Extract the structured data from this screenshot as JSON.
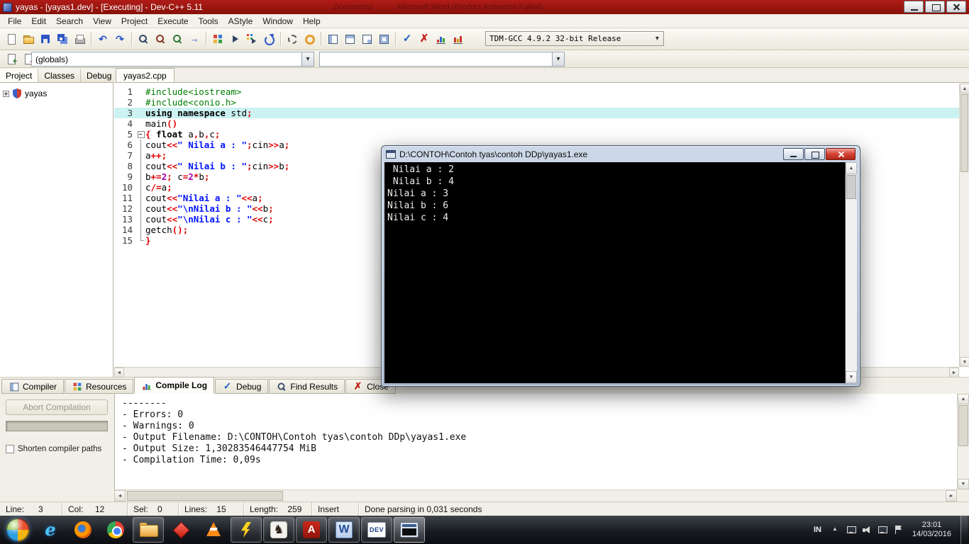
{
  "colors": {
    "titlebar": "#9b1512",
    "ui_beige": "#f1efe7",
    "highlight_line": "#ccf2f2",
    "console_bg": "#000000",
    "syntax": {
      "preprocessor": "#007d00",
      "keyword": "#000000",
      "string": "#0014ff",
      "symbol": "#e00000",
      "number": "#aa00aa"
    }
  },
  "window": {
    "title": "yayas - [yayas1.dev] - [Executing] - Dev-C++ 5.11",
    "background_hint1": "Documents",
    "background_hint2": "Microsoft Word (Product Activation Failed)"
  },
  "menu": {
    "items": [
      "File",
      "Edit",
      "Search",
      "View",
      "Project",
      "Execute",
      "Tools",
      "AStyle",
      "Window",
      "Help"
    ]
  },
  "toolbar": {
    "compiler_selected": "TDM-GCC 4.9.2 32-bit Release",
    "buttons": [
      {
        "name": "new-file-button",
        "icon": "page",
        "icon_name": "new-file-icon",
        "inter": "true"
      },
      {
        "name": "open-file-button",
        "icon": "folder",
        "icon_name": "open-folder-icon",
        "inter": "true"
      },
      {
        "name": "save-button",
        "icon": "floppy",
        "icon_name": "save-icon",
        "inter": "true"
      },
      {
        "name": "save-all-button",
        "icon": "floppy2",
        "icon_name": "save-all-icon",
        "inter": "true"
      },
      {
        "name": "print-button",
        "icon": "printer",
        "icon_name": "print-icon",
        "inter": "true"
      },
      {
        "name": "toolbar-separator",
        "icon": "sep",
        "kind": "sep",
        "icon_name": "separator",
        "inter": "false"
      },
      {
        "name": "undo-button",
        "icon": "undo",
        "icon_name": "undo-icon",
        "inter": "true"
      },
      {
        "name": "redo-button",
        "icon": "redo",
        "icon_name": "redo-icon",
        "inter": "true"
      },
      {
        "name": "toolbar-separator",
        "icon": "sep",
        "kind": "sep",
        "icon_name": "separator",
        "inter": "false"
      },
      {
        "name": "find-button",
        "icon": "find",
        "icon_name": "find-icon",
        "inter": "true"
      },
      {
        "name": "replace-button",
        "icon": "replace",
        "icon_name": "replace-icon",
        "inter": "true"
      },
      {
        "name": "find-next-button",
        "icon": "findnav",
        "icon_name": "find-next-icon",
        "inter": "true"
      },
      {
        "name": "goto-line-button",
        "icon": "goto",
        "icon_name": "goto-line-icon",
        "inter": "true"
      },
      {
        "name": "toolbar-separator",
        "icon": "sep",
        "kind": "sep",
        "icon_name": "separator",
        "inter": "false"
      },
      {
        "name": "compile-button",
        "icon": "compile",
        "icon_name": "compile-icon",
        "inter": "true"
      },
      {
        "name": "run-button",
        "icon": "run",
        "icon_name": "run-icon",
        "inter": "true"
      },
      {
        "name": "compile-run-button",
        "icon": "comprun",
        "icon_name": "compile-run-icon",
        "inter": "true"
      },
      {
        "name": "rebuild-button",
        "icon": "rebuild",
        "icon_name": "rebuild-icon",
        "inter": "true"
      },
      {
        "name": "toolbar-separator",
        "icon": "sep",
        "kind": "sep",
        "icon_name": "separator",
        "inter": "false"
      },
      {
        "name": "debug-button",
        "icon": "gear",
        "icon_name": "debug-icon",
        "inter": "true"
      },
      {
        "name": "profile-button",
        "icon": "donut",
        "icon_name": "profile-icon",
        "inter": "true"
      },
      {
        "name": "toolbar-separator",
        "icon": "sep",
        "kind": "sep",
        "icon_name": "separator",
        "inter": "false"
      },
      {
        "name": "toggle-project-panel-button",
        "icon": "grid-a",
        "icon_name": "panel-layout-left-icon",
        "inter": "true"
      },
      {
        "name": "toggle-report-panel-button",
        "icon": "grid-b",
        "icon_name": "panel-layout-top-icon",
        "inter": "true"
      },
      {
        "name": "toggle-output-panel-button",
        "icon": "grid-c",
        "icon_name": "panel-layout-corner-icon",
        "inter": "true"
      },
      {
        "name": "toggle-fullscreen-button",
        "icon": "grid-d",
        "icon_name": "panel-layout-full-icon",
        "inter": "true"
      },
      {
        "name": "toolbar-separator",
        "icon": "sep",
        "kind": "sep",
        "icon_name": "separator",
        "inter": "false"
      },
      {
        "name": "syntax-check-button",
        "icon": "check",
        "icon_name": "syntax-check-icon",
        "inter": "true"
      },
      {
        "name": "abort-compilation-toolbar-button",
        "icon": "abortx",
        "icon_name": "abort-icon",
        "inter": "true"
      },
      {
        "name": "profile-analysis-button",
        "icon": "chart",
        "icon_name": "profile-chart-icon",
        "inter": "true"
      },
      {
        "name": "delete-profiling-button",
        "icon": "chart2",
        "icon_name": "delete-profiling-icon",
        "inter": "true"
      }
    ]
  },
  "toolbar2": {
    "globals_selected": "(globals)",
    "members_selected": "",
    "buttons": [
      {
        "name": "add-to-project-button",
        "icon": "pageplus",
        "icon_name": "add-file-icon",
        "inter": "true"
      },
      {
        "name": "remove-from-project-button",
        "icon": "pageminus",
        "icon_name": "remove-file-icon",
        "inter": "true"
      },
      {
        "name": "project-options-button",
        "icon": "pagegear",
        "icon_name": "project-options-icon",
        "inter": "true"
      }
    ]
  },
  "left_panel": {
    "tabs": [
      {
        "label": "Project",
        "name": "tab-project",
        "state": "active"
      },
      {
        "label": "Classes",
        "name": "tab-classes"
      },
      {
        "label": "Debug",
        "name": "tab-debug"
      }
    ],
    "tree_item": "yayas"
  },
  "editor": {
    "tab": "yayas2.cpp",
    "lines": [
      {
        "n": "1",
        "tokens": [
          {
            "t": "#include<iostream>",
            "c": "pp"
          }
        ]
      },
      {
        "n": "2",
        "tokens": [
          {
            "t": "#include<conio.h>",
            "c": "pp"
          }
        ]
      },
      {
        "n": "3",
        "hl": true,
        "tokens": [
          {
            "t": "using namespace",
            "c": "kw"
          },
          {
            "t": " std",
            "c": "id"
          },
          {
            "t": ";",
            "c": "sym"
          }
        ]
      },
      {
        "n": "4",
        "tokens": [
          {
            "t": "main",
            "c": "id"
          },
          {
            "t": "()",
            "c": "sym"
          }
        ]
      },
      {
        "n": "5",
        "fold": "start",
        "tokens": [
          {
            "t": "{ ",
            "c": "sym"
          },
          {
            "t": "float",
            "c": "kw"
          },
          {
            "t": " a",
            "c": "id"
          },
          {
            "t": ",",
            "c": "sym"
          },
          {
            "t": "b",
            "c": "id"
          },
          {
            "t": ",",
            "c": "sym"
          },
          {
            "t": "c",
            "c": "id"
          },
          {
            "t": ";",
            "c": "sym"
          }
        ]
      },
      {
        "n": "6",
        "fold": "mid",
        "tokens": [
          {
            "t": "cout",
            "c": "id"
          },
          {
            "t": "<<",
            "c": "sym"
          },
          {
            "t": "\" Nilai a : \"",
            "c": "str"
          },
          {
            "t": ";",
            "c": "sym"
          },
          {
            "t": "cin",
            "c": "id"
          },
          {
            "t": ">>",
            "c": "sym"
          },
          {
            "t": "a",
            "c": "id"
          },
          {
            "t": ";",
            "c": "sym"
          }
        ]
      },
      {
        "n": "7",
        "fold": "mid",
        "tokens": [
          {
            "t": "a",
            "c": "id"
          },
          {
            "t": "++;",
            "c": "sym"
          }
        ]
      },
      {
        "n": "8",
        "fold": "mid",
        "tokens": [
          {
            "t": "cout",
            "c": "id"
          },
          {
            "t": "<<",
            "c": "sym"
          },
          {
            "t": "\" Nilai b : \"",
            "c": "str"
          },
          {
            "t": ";",
            "c": "sym"
          },
          {
            "t": "cin",
            "c": "id"
          },
          {
            "t": ">>",
            "c": "sym"
          },
          {
            "t": "b",
            "c": "id"
          },
          {
            "t": ";",
            "c": "sym"
          }
        ]
      },
      {
        "n": "9",
        "fold": "mid",
        "tokens": [
          {
            "t": "b",
            "c": "id"
          },
          {
            "t": "+=",
            "c": "sym"
          },
          {
            "t": "2",
            "c": "num"
          },
          {
            "t": "; ",
            "c": "sym"
          },
          {
            "t": "c",
            "c": "id"
          },
          {
            "t": "=",
            "c": "sym"
          },
          {
            "t": "2",
            "c": "num"
          },
          {
            "t": "*",
            "c": "sym"
          },
          {
            "t": "b",
            "c": "id"
          },
          {
            "t": ";",
            "c": "sym"
          }
        ]
      },
      {
        "n": "10",
        "fold": "mid",
        "tokens": [
          {
            "t": "c",
            "c": "id"
          },
          {
            "t": "/=",
            "c": "sym"
          },
          {
            "t": "a",
            "c": "id"
          },
          {
            "t": ";",
            "c": "sym"
          }
        ]
      },
      {
        "n": "11",
        "fold": "mid",
        "tokens": [
          {
            "t": "cout",
            "c": "id"
          },
          {
            "t": "<<",
            "c": "sym"
          },
          {
            "t": "\"Nilai a : \"",
            "c": "str"
          },
          {
            "t": "<<",
            "c": "sym"
          },
          {
            "t": "a",
            "c": "id"
          },
          {
            "t": ";",
            "c": "sym"
          }
        ]
      },
      {
        "n": "12",
        "fold": "mid",
        "tokens": [
          {
            "t": "cout",
            "c": "id"
          },
          {
            "t": "<<",
            "c": "sym"
          },
          {
            "t": "\"\\nNilai b : \"",
            "c": "str"
          },
          {
            "t": "<<",
            "c": "sym"
          },
          {
            "t": "b",
            "c": "id"
          },
          {
            "t": ";",
            "c": "sym"
          }
        ]
      },
      {
        "n": "13",
        "fold": "mid",
        "tokens": [
          {
            "t": "cout",
            "c": "id"
          },
          {
            "t": "<<",
            "c": "sym"
          },
          {
            "t": "\"\\nNilai c : \"",
            "c": "str"
          },
          {
            "t": "<<",
            "c": "sym"
          },
          {
            "t": "c",
            "c": "id"
          },
          {
            "t": ";",
            "c": "sym"
          }
        ]
      },
      {
        "n": "14",
        "fold": "mid",
        "tokens": [
          {
            "t": "getch",
            "c": "id"
          },
          {
            "t": "();",
            "c": "sym"
          }
        ]
      },
      {
        "n": "15",
        "fold": "end",
        "tokens": [
          {
            "t": "}",
            "c": "sym"
          }
        ]
      }
    ]
  },
  "console": {
    "title": "D:\\CONTOH\\Contoh tyas\\contoh DDp\\yayas1.exe",
    "lines": [
      " Nilai a : 2",
      " Nilai b : 4",
      "Nilai a : 3",
      "Nilai b : 6",
      "Nilai c : 4"
    ]
  },
  "bottom_tabs": [
    {
      "label": "Compiler",
      "name": "tab-compiler",
      "icon": "grid-a",
      "icon_name": "compiler-tab-icon"
    },
    {
      "label": "Resources",
      "name": "tab-resources",
      "icon": "compile",
      "icon_name": "resources-tab-icon"
    },
    {
      "label": "Compile Log",
      "name": "tab-compile-log",
      "icon": "chart",
      "icon_name": "compile-log-tab-icon",
      "state": "active"
    },
    {
      "label": "Debug",
      "name": "tab-debug-bottom",
      "icon": "check",
      "icon_name": "debug-tab-icon"
    },
    {
      "label": "Find Results",
      "name": "tab-find-results",
      "icon": "find",
      "icon_name": "find-results-tab-icon"
    },
    {
      "label": "Close",
      "name": "tab-close",
      "icon": "abortx",
      "icon_name": "close-tab-icon"
    }
  ],
  "compile_panel": {
    "abort_button": "Abort Compilation",
    "shorten_label": "Shorten compiler paths",
    "log": [
      "--------",
      "- Errors: 0",
      "- Warnings: 0",
      "- Output Filename: D:\\CONTOH\\Contoh tyas\\contoh DDp\\yayas1.exe",
      "- Output Size: 1,30283546447754 MiB",
      "- Compilation Time: 0,09s"
    ]
  },
  "status_bar": {
    "segments": [
      "Line:      3",
      "Col:     12",
      "Sel:    0",
      "Lines:    15",
      "Length:    259",
      "Insert",
      "Done parsing in 0,031 seconds"
    ]
  },
  "taskbar": {
    "items": [
      {
        "name": "taskbar-internet-explorer",
        "icon": "ic-ie",
        "icon_name": "internet-explorer-icon"
      },
      {
        "name": "taskbar-firefox",
        "icon": "ic-firefox",
        "icon_name": "firefox-icon"
      },
      {
        "name": "taskbar-chrome",
        "icon": "ic-chrome",
        "icon_name": "chrome-icon"
      },
      {
        "name": "taskbar-explorer",
        "icon": "ic-folder",
        "icon_name": "explorer-folder-icon",
        "state": "open"
      },
      {
        "name": "taskbar-red-diamond-app",
        "icon": "ic-diamond",
        "icon_name": "red-diamond-icon"
      },
      {
        "name": "taskbar-media-app",
        "icon": "ic-cone",
        "icon_name": "orange-cone-icon"
      },
      {
        "name": "taskbar-winamp",
        "icon": "ic-lightning",
        "icon_name": "lightning-icon",
        "state": "open"
      },
      {
        "name": "taskbar-kangaroo-app",
        "icon": "ic-kangaroo",
        "icon_name": "kangaroo-icon",
        "state": "open"
      },
      {
        "name": "taskbar-adobe-reader",
        "icon": "ic-adobe",
        "icon_name": "adobe-reader-icon",
        "state": "open"
      },
      {
        "name": "taskbar-word",
        "icon": "ic-word",
        "icon_name": "word-icon",
        "state": "open"
      },
      {
        "name": "taskbar-dev-cpp",
        "icon": "ic-dev",
        "icon_name": "dev-cpp-icon",
        "state": "open"
      },
      {
        "name": "taskbar-console-window",
        "icon": "ic-console",
        "icon_name": "console-window-icon",
        "state": "active"
      }
    ],
    "tray": {
      "language": "IN",
      "icons": [
        {
          "name": "hidden-icons-button",
          "kind": "arrowup"
        },
        {
          "name": "display-icon",
          "kind": "monitor"
        },
        {
          "name": "volume-icon",
          "kind": "volume"
        },
        {
          "name": "network-icon",
          "kind": "monitor"
        },
        {
          "name": "action-center-icon",
          "kind": "flag"
        }
      ],
      "time": "23:01",
      "date": "14/03/2016"
    }
  }
}
